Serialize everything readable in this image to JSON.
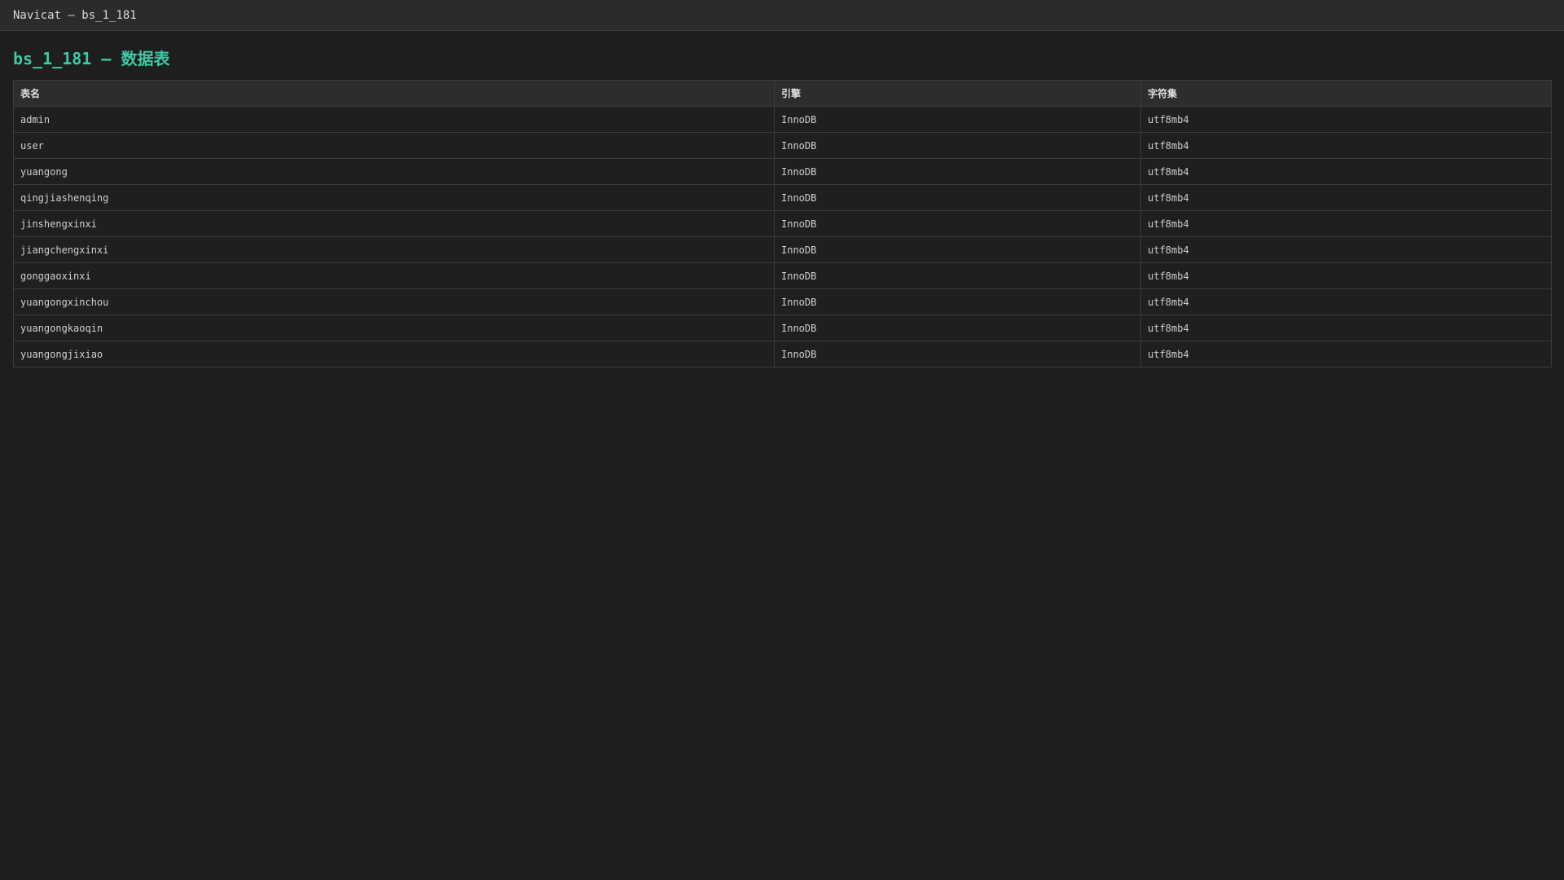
{
  "window": {
    "title": "Navicat — bs_1_181"
  },
  "page": {
    "title": "bs_1_181 — 数据表"
  },
  "table": {
    "headers": {
      "name": "表名",
      "engine": "引擎",
      "charset": "字符集"
    },
    "rows": [
      {
        "name": "admin",
        "engine": "InnoDB",
        "charset": "utf8mb4"
      },
      {
        "name": "user",
        "engine": "InnoDB",
        "charset": "utf8mb4"
      },
      {
        "name": "yuangong",
        "engine": "InnoDB",
        "charset": "utf8mb4"
      },
      {
        "name": "qingjiashenqing",
        "engine": "InnoDB",
        "charset": "utf8mb4"
      },
      {
        "name": "jinshengxinxi",
        "engine": "InnoDB",
        "charset": "utf8mb4"
      },
      {
        "name": "jiangchengxinxi",
        "engine": "InnoDB",
        "charset": "utf8mb4"
      },
      {
        "name": "gonggaoxinxi",
        "engine": "InnoDB",
        "charset": "utf8mb4"
      },
      {
        "name": "yuangongxinchou",
        "engine": "InnoDB",
        "charset": "utf8mb4"
      },
      {
        "name": "yuangongkaoqin",
        "engine": "InnoDB",
        "charset": "utf8mb4"
      },
      {
        "name": "yuangongjixiao",
        "engine": "InnoDB",
        "charset": "utf8mb4"
      }
    ]
  },
  "colors": {
    "accent": "#3ec9a5",
    "background": "#1e1e1e",
    "titlebar": "#2b2b2d",
    "border": "#3c3c3c"
  }
}
